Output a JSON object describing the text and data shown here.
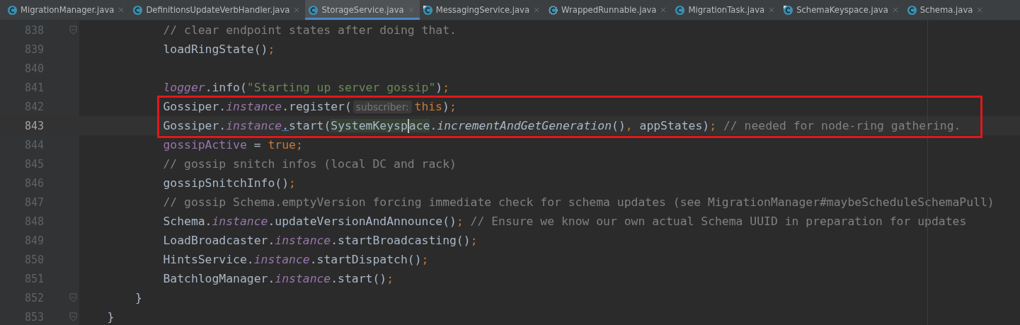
{
  "tabs": [
    {
      "label": "MigrationManager.java",
      "selected": false,
      "kind": "class"
    },
    {
      "label": "DefinitionsUpdateVerbHandler.java",
      "selected": false,
      "kind": "class"
    },
    {
      "label": "StorageService.java",
      "selected": true,
      "kind": "class"
    },
    {
      "label": "MessagingService.java",
      "selected": false,
      "kind": "runnable"
    },
    {
      "label": "WrappedRunnable.java",
      "selected": false,
      "kind": "abstract"
    },
    {
      "label": "MigrationTask.java",
      "selected": false,
      "kind": "class"
    },
    {
      "label": "SchemaKeyspace.java",
      "selected": false,
      "kind": "runnable"
    },
    {
      "label": "Schema.java",
      "selected": false,
      "kind": "class"
    }
  ],
  "editor": {
    "body": [
      {
        "children": [
          {
            "children": [
              {
                "number": "838",
                "fold": true,
                "current": false,
                "annotated": false,
                "tokens": [
                  {
                    "kind": "comment",
                    "text": "// clear endpoint states after doing that."
                  }
                ]
              },
              {
                "number": "839",
                "fold": false,
                "current": false,
                "annotated": false,
                "tokens": [
                  {
                    "kind": "plain",
                    "text": "loadRingState()"
                  },
                  {
                    "kind": "keyword",
                    "text": ";"
                  }
                ]
              },
              {
                "number": "840",
                "fold": false,
                "current": false,
                "annotated": false
              },
              {
                "number": "841",
                "fold": false,
                "current": false,
                "annotated": false,
                "tokens": [
                  {
                    "kind": "static-field",
                    "text": "logger"
                  },
                  {
                    "kind": "plain",
                    "text": ".info("
                  },
                  {
                    "kind": "string",
                    "text": "\"Starting up server gossip\""
                  },
                  {
                    "kind": "plain",
                    "text": ")"
                  },
                  {
                    "kind": "keyword",
                    "text": ";"
                  }
                ]
              },
              {
                "number": "842",
                "fold": false,
                "current": false,
                "annotated": true,
                "tokens": [
                  {
                    "kind": "plain",
                    "text": "Gossiper."
                  },
                  {
                    "kind": "static-field",
                    "text": "instance"
                  },
                  {
                    "kind": "plain",
                    "text": ".register("
                  },
                  {
                    "kind": "hint",
                    "text": "subscriber:"
                  },
                  {
                    "kind": "keyword",
                    "text": "this"
                  },
                  {
                    "kind": "plain",
                    "text": ")"
                  },
                  {
                    "kind": "keyword",
                    "text": ";"
                  }
                ]
              },
              {
                "number": "843",
                "fold": false,
                "current": true,
                "annotated": true,
                "tokens": [
                  {
                    "kind": "plain",
                    "text": "Gossiper."
                  },
                  {
                    "kind": "static-field",
                    "text": "instance"
                  },
                  {
                    "kind": "link",
                    "text": "."
                  },
                  {
                    "kind": "plain",
                    "text": "start("
                  },
                  {
                    "kind": "usage",
                    "text": "SystemKeysp",
                    "caret": true
                  },
                  {
                    "kind": "usage",
                    "text": "ace",
                    "caret": false
                  },
                  {
                    "kind": "plain",
                    "text": "."
                  },
                  {
                    "kind": "static-method",
                    "text": "incrementAndGetGeneration"
                  },
                  {
                    "kind": "plain",
                    "text": "()"
                  },
                  {
                    "kind": "keyword",
                    "text": ","
                  },
                  {
                    "kind": "plain",
                    "text": " appStates)"
                  },
                  {
                    "kind": "keyword",
                    "text": ";"
                  },
                  {
                    "kind": "comment",
                    "text": " // needed for node-ring gathering."
                  }
                ]
              },
              {
                "number": "844",
                "fold": false,
                "current": false,
                "annotated": false,
                "tokens": [
                  {
                    "kind": "field",
                    "text": "gossipActive"
                  },
                  {
                    "kind": "plain",
                    "text": " = "
                  },
                  {
                    "kind": "keyword",
                    "text": "true;"
                  }
                ]
              },
              {
                "number": "845",
                "fold": false,
                "current": false,
                "annotated": false,
                "tokens": [
                  {
                    "kind": "comment",
                    "text": "// gossip snitch infos (local DC and rack)"
                  }
                ]
              },
              {
                "number": "846",
                "fold": false,
                "current": false,
                "annotated": false,
                "tokens": [
                  {
                    "kind": "plain",
                    "text": "gossipSnitchInfo()"
                  },
                  {
                    "kind": "keyword",
                    "text": ";"
                  }
                ]
              },
              {
                "number": "847",
                "fold": false,
                "current": false,
                "annotated": false,
                "tokens": [
                  {
                    "kind": "comment",
                    "text": "// gossip Schema.emptyVersion forcing immediate check for schema updates (see MigrationManager#maybeScheduleSchemaPull)"
                  }
                ]
              },
              {
                "number": "848",
                "fold": false,
                "current": false,
                "annotated": false,
                "tokens": [
                  {
                    "kind": "plain",
                    "text": "Schema."
                  },
                  {
                    "kind": "static-field",
                    "text": "instance"
                  },
                  {
                    "kind": "plain",
                    "text": ".updateVersionAndAnnounce()"
                  },
                  {
                    "kind": "keyword",
                    "text": ";"
                  },
                  {
                    "kind": "comment",
                    "text": " // Ensure we know our own actual Schema UUID in preparation for updates"
                  }
                ]
              },
              {
                "number": "849",
                "fold": false,
                "current": false,
                "annotated": false,
                "tokens": [
                  {
                    "kind": "plain",
                    "text": "LoadBroadcaster."
                  },
                  {
                    "kind": "static-field",
                    "text": "instance"
                  },
                  {
                    "kind": "plain",
                    "text": ".startBroadcasting()"
                  },
                  {
                    "kind": "keyword",
                    "text": ";"
                  }
                ]
              },
              {
                "number": "850",
                "fold": false,
                "current": false,
                "annotated": false,
                "tokens": [
                  {
                    "kind": "plain",
                    "text": "HintsService."
                  },
                  {
                    "kind": "static-field",
                    "text": "instance"
                  },
                  {
                    "kind": "plain",
                    "text": ".startDispatch()"
                  },
                  {
                    "kind": "keyword",
                    "text": ";"
                  }
                ]
              },
              {
                "number": "851",
                "fold": false,
                "current": false,
                "annotated": false,
                "tokens": [
                  {
                    "kind": "plain",
                    "text": "BatchlogManager."
                  },
                  {
                    "kind": "static-field",
                    "text": "instance"
                  },
                  {
                    "kind": "plain",
                    "text": ".start()"
                  },
                  {
                    "kind": "keyword",
                    "text": ";"
                  }
                ]
              }
            ]
          },
          {
            "number": "852",
            "fold": true,
            "current": false,
            "annotated": false,
            "tokens": [
              {
                "kind": "plain",
                "text": "}"
              }
            ]
          }
        ]
      },
      {
        "number": "853",
        "fold": true,
        "current": false,
        "annotated": false,
        "tokens": [
          {
            "kind": "plain",
            "text": "}"
          }
        ]
      }
    ]
  }
}
